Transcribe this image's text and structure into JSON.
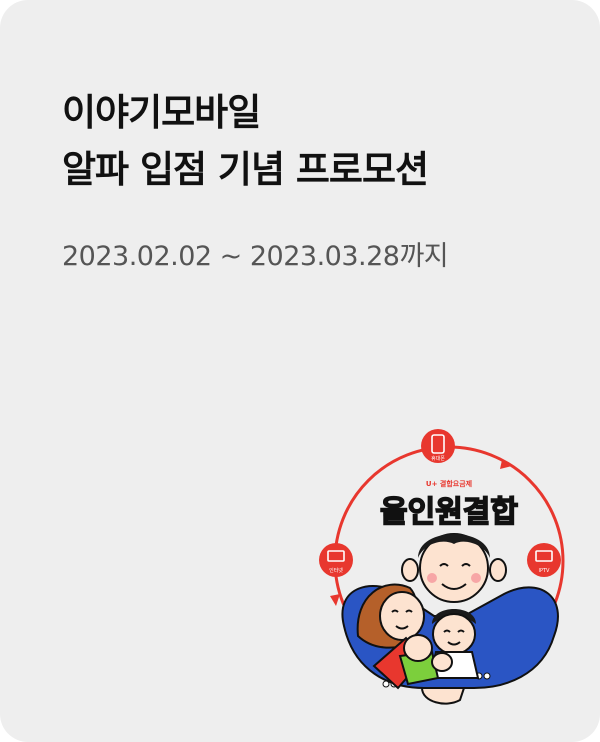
{
  "promo": {
    "title_line1": "이야기모바일",
    "title_line2": "알파 입점 기념 프로모션",
    "period": "2023.02.02 ~ 2023.03.28까지"
  },
  "illustration": {
    "subtitle": "U+ 결합요금제",
    "headline": "올인원결합",
    "icon_top_label": "휴대폰",
    "icon_left_label": "인터넷",
    "icon_right_label": "IPTV",
    "accent_color": "#e8372e",
    "icons": [
      "phone-icon",
      "monitor-icon",
      "tv-icon"
    ]
  }
}
